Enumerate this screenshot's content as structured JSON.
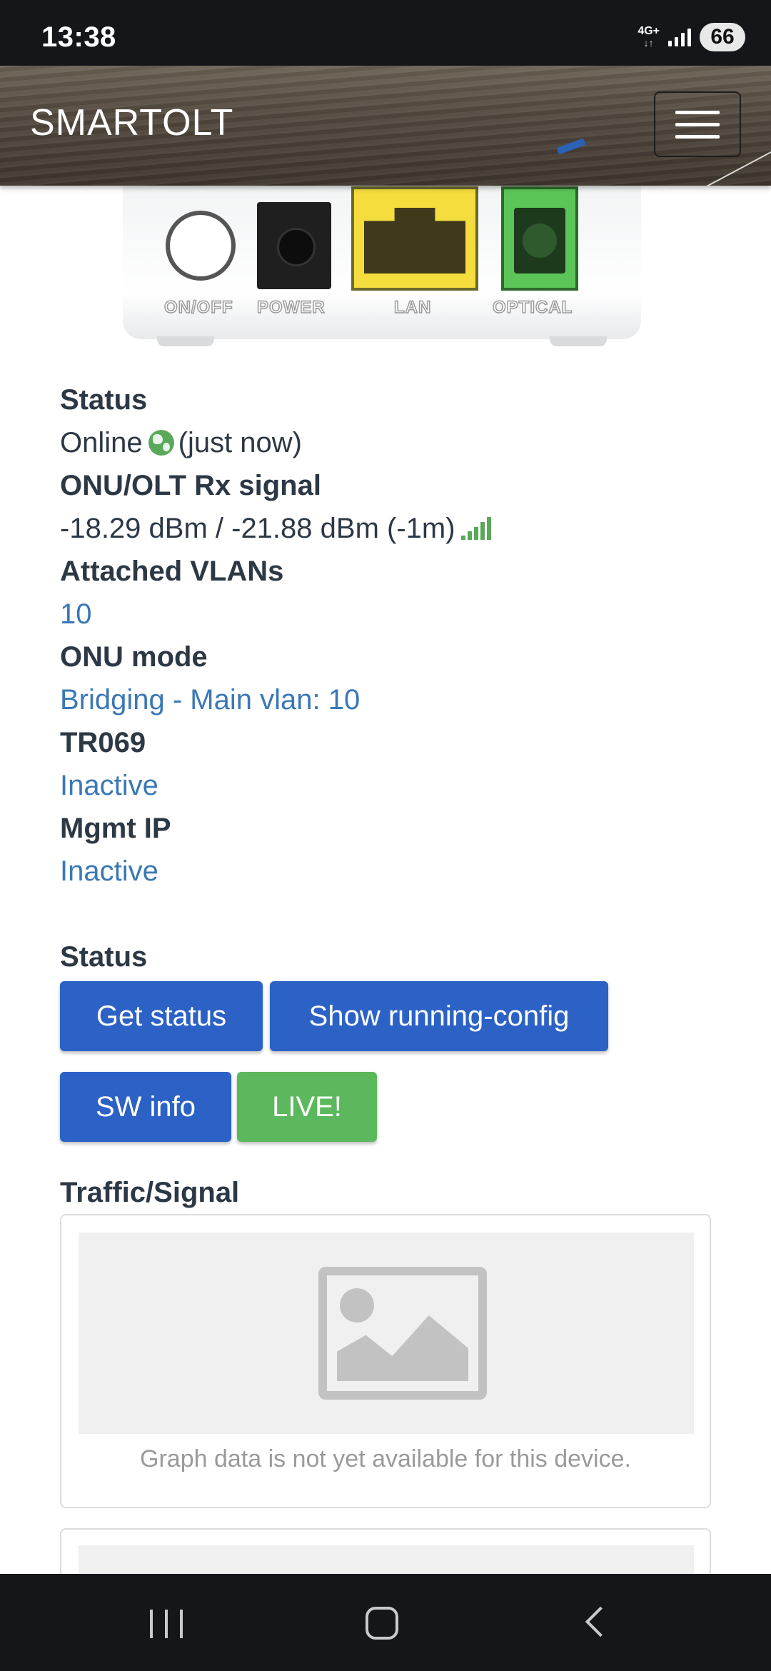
{
  "status_bar": {
    "time": "13:38",
    "network_type": "4G+",
    "battery": "66"
  },
  "navbar": {
    "brand": "SMARTOLT"
  },
  "device_image": {
    "port_labels": [
      "ON/OFF",
      "POWER",
      "LAN",
      "OPTICAL"
    ]
  },
  "onu_info": {
    "status_label": "Status",
    "status_value": "Online",
    "status_time": "(just now)",
    "rx_signal_label": "ONU/OLT Rx signal",
    "rx_signal_value": "-18.29 dBm / -21.88 dBm (-1m)",
    "vlans_label": "Attached VLANs",
    "vlans_value": "10",
    "mode_label": "ONU mode",
    "mode_value": "Bridging - Main vlan: 10",
    "tr069_label": "TR069",
    "tr069_value": "Inactive",
    "mgmt_ip_label": "Mgmt IP",
    "mgmt_ip_value": "Inactive"
  },
  "status_section": {
    "title": "Status",
    "buttons": {
      "get_status": "Get status",
      "show_running_config": "Show running-config",
      "sw_info": "SW info",
      "live": "LIVE!"
    }
  },
  "traffic_section": {
    "title": "Traffic/Signal",
    "placeholder_caption": "Graph data is not yet available for this device."
  },
  "colors": {
    "button_blue": "#2c62c6",
    "button_green": "#5cb85c",
    "link_blue": "#3a78b5",
    "online_green": "#5aa95a"
  },
  "icons": {
    "status_online": "globe-icon",
    "signal_strength": "signal-bars-icon",
    "menu": "hamburger-menu-icon",
    "graph_placeholder": "image-placeholder-icon"
  }
}
